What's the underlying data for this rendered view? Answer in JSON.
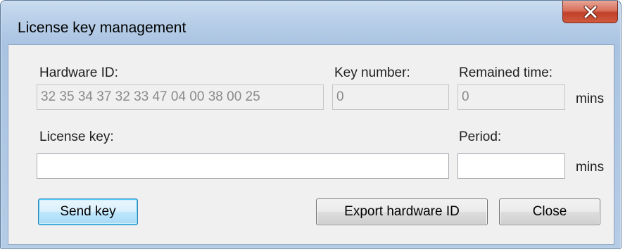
{
  "window": {
    "title": "License key management"
  },
  "titlebar": {
    "close_icon": "close-x-icon"
  },
  "form": {
    "hardware_id_label": "Hardware ID:",
    "hardware_id_value": "32 35 34 37 32 33 47 04 00 38 00 25",
    "key_number_label": "Key number:",
    "key_number_value": "0",
    "remained_time_label": "Remained time:",
    "remained_time_value": "0",
    "remained_time_unit": "mins",
    "license_key_label": "License key:",
    "license_key_value": "",
    "period_label": "Period:",
    "period_value": "",
    "period_unit": "mins"
  },
  "buttons": {
    "send_key": "Send key",
    "export_hardware_id": "Export hardware ID",
    "close": "Close"
  },
  "colors": {
    "titlebar": "#b9cfe8",
    "close_button": "#c2402a",
    "client_bg": "#f0f0f0",
    "default_button_border": "#3c7fb1"
  }
}
